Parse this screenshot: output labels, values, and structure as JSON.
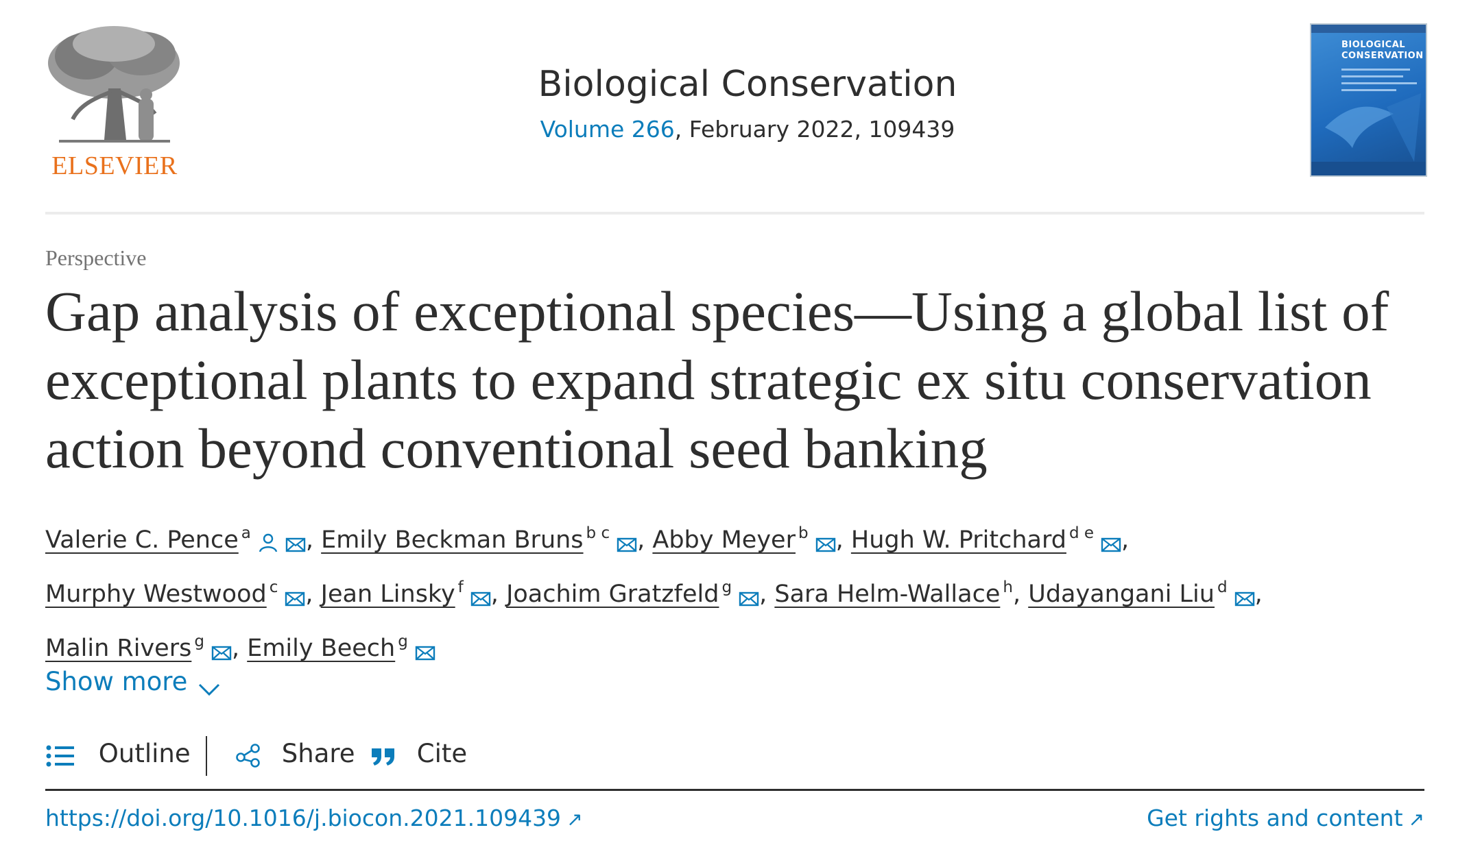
{
  "publisher": {
    "logo_text": "ELSEVIER",
    "logo_color": "#e9711c"
  },
  "journal": {
    "title": "Biological Conservation",
    "volume_link": "Volume 266",
    "meta_rest": ", February 2022, 109439",
    "cover_title_line1": "BIOLOGICAL",
    "cover_title_line2": "CONSERVATION"
  },
  "article": {
    "type": "Perspective",
    "title": "Gap analysis of exceptional species—Using a global list of exceptional plants to expand strategic ex situ conservation action beyond conventional seed banking"
  },
  "authors": [
    {
      "name": "Valerie C. Pence",
      "aff": "a",
      "person_icon": true,
      "suffix": ","
    },
    {
      "name": "Emily Beckman Bruns",
      "aff": "b c",
      "person_icon": false,
      "suffix": ","
    },
    {
      "name": "Abby Meyer",
      "aff": "b",
      "person_icon": false,
      "suffix": ","
    },
    {
      "name": "Hugh W. Pritchard",
      "aff": "d e",
      "person_icon": false,
      "suffix": ","
    },
    {
      "name": "Murphy Westwood",
      "aff": "c",
      "person_icon": false,
      "suffix": ","
    },
    {
      "name": "Jean Linsky",
      "aff": "f",
      "person_icon": false,
      "suffix": ","
    },
    {
      "name": "Joachim Gratzfeld",
      "aff": "g",
      "person_icon": false,
      "suffix": ","
    },
    {
      "name": "Sara Helm-Wallace",
      "aff": "h",
      "person_icon": false,
      "suffix": ",",
      "no_email": true
    },
    {
      "name": "Udayangani Liu",
      "aff": "d",
      "person_icon": false,
      "suffix": ","
    },
    {
      "name": "Malin Rivers",
      "aff": "g",
      "person_icon": false,
      "suffix": ","
    },
    {
      "name": "Emily Beech",
      "aff": "g",
      "person_icon": false,
      "suffix": ""
    }
  ],
  "show_more": "Show more",
  "toolbar": {
    "outline": "Outline",
    "share": "Share",
    "cite": "Cite"
  },
  "links": {
    "doi": "https://doi.org/10.1016/j.biocon.2021.109439",
    "rights": "Get rights and content",
    "ext_arrow": "↗"
  },
  "colors": {
    "link": "#0c7dbb",
    "text": "#2e2e2e",
    "muted": "#737373"
  }
}
